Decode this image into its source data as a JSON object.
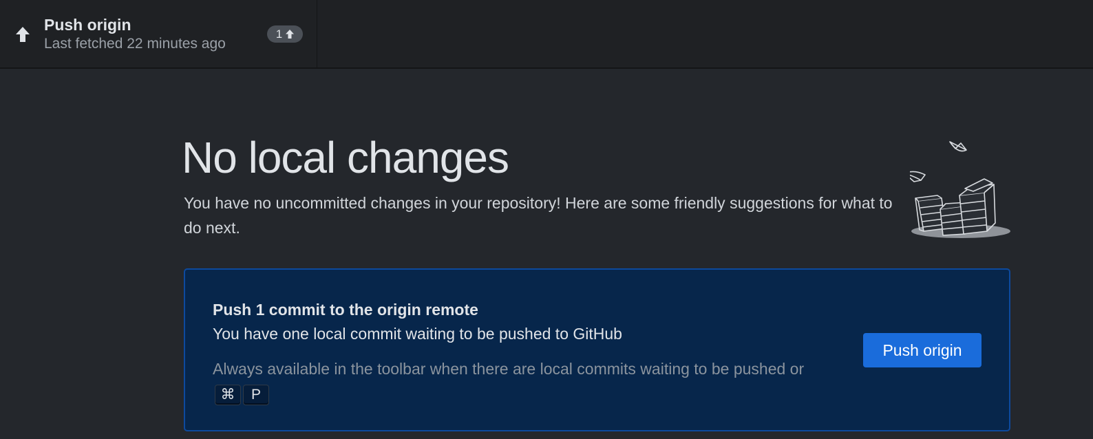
{
  "toolbar": {
    "push_title": "Push origin",
    "push_description": "Last fetched 22 minutes ago",
    "ahead_count": "1",
    "icon": "arrow-up-icon"
  },
  "main": {
    "heading": "No local changes",
    "subtext": "You have no uncommitted changes in your repository! Here are some friendly suggestions for what to do next.",
    "illustration": "paper-stacks-illustration"
  },
  "suggestion_card": {
    "title": "Push 1 commit to the origin remote",
    "description": "You have one local commit waiting to be pushed to GitHub",
    "hint_text": "Always available in the toolbar when there are local commits waiting to be pushed or",
    "shortcut_keys": [
      "⌘",
      "P"
    ],
    "button_label": "Push origin"
  },
  "colors": {
    "background": "#24272c",
    "toolbar": "#1f2124",
    "card_background": "#07264b",
    "card_border": "#0d4a9e",
    "primary_button": "#1a6cdb"
  }
}
